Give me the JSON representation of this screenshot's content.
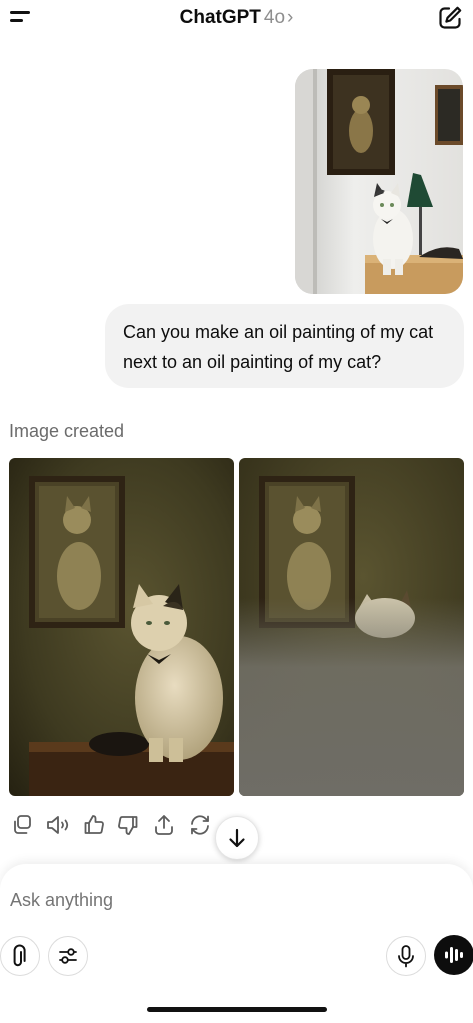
{
  "header": {
    "app_name": "ChatGPT",
    "model": "4o",
    "chevron": "›"
  },
  "conversation": {
    "user_message": "Can you make an oil painting of my cat next to an oil painting of my cat?",
    "assistant_status": "Image created"
  },
  "composer": {
    "placeholder": "Ask anything"
  },
  "icons": {
    "menu": "menu-icon",
    "new_chat": "new-chat-icon",
    "copy": "copy-icon",
    "read_aloud": "speaker-icon",
    "like": "thumbs-up-icon",
    "dislike": "thumbs-down-icon",
    "share": "share-icon",
    "regenerate": "regenerate-icon",
    "scroll_down": "arrow-down-icon",
    "attach": "paperclip-icon",
    "tools": "sliders-icon",
    "mic": "microphone-icon",
    "voice": "voice-mode-icon"
  },
  "colors": {
    "bubble": "#f2f2f2",
    "muted_text": "#8e8e8e",
    "voice_button": "#0d0d0d"
  }
}
